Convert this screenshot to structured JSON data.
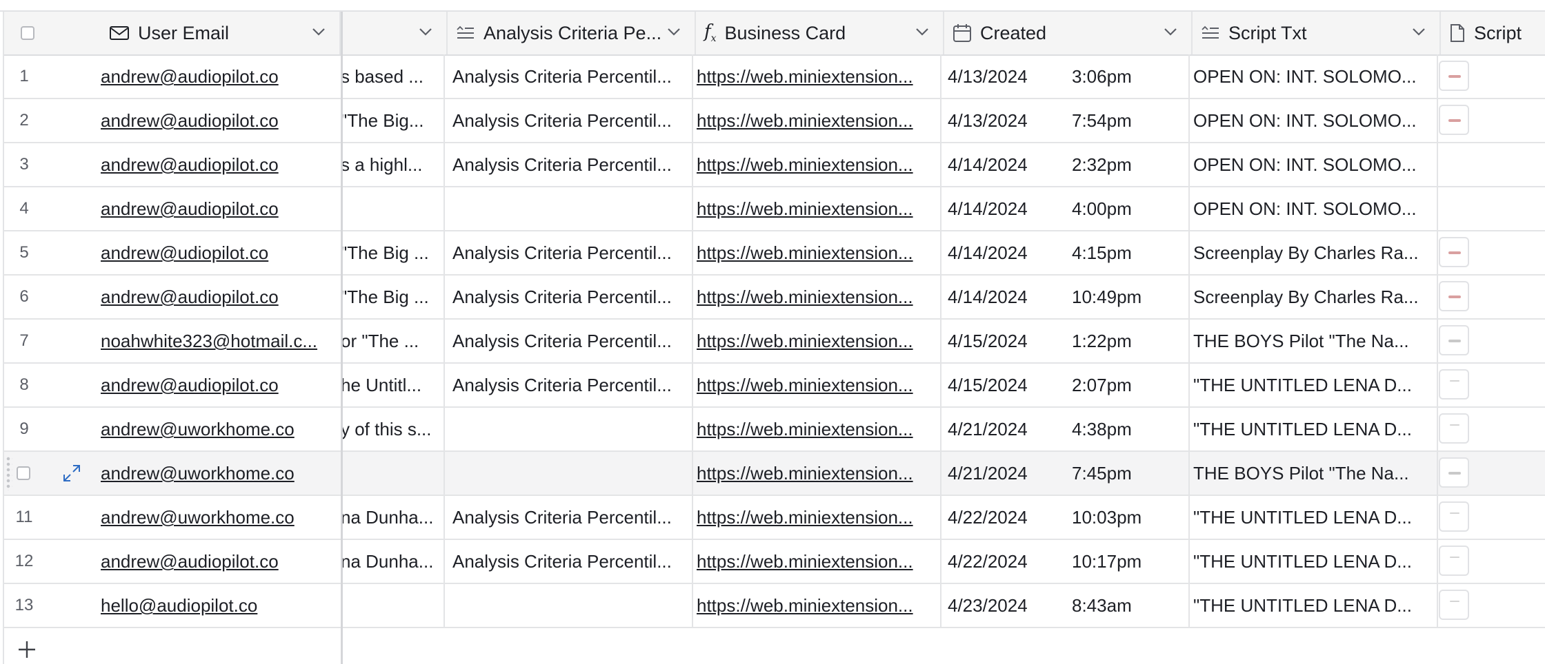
{
  "header": {
    "user_email": "User Email",
    "analysis_criteria": "Analysis Criteria Pe...",
    "business_card": "Business Card",
    "created": "Created",
    "script_txt": "Script Txt",
    "script": "Script"
  },
  "rows": [
    {
      "num": "1",
      "email": "andrew@audiopilot.co",
      "c1": "s based ...",
      "c2": "Analysis Criteria Percentil...",
      "c3": "https://web.miniextension...",
      "date": "4/13/2024",
      "time": "3:06pm",
      "c5": "OPEN ON: INT. SOLOMO...",
      "thumb": "red"
    },
    {
      "num": "2",
      "email": "andrew@audiopilot.co",
      "c1": "\"The Big...",
      "c2": "Analysis Criteria Percentil...",
      "c3": "https://web.miniextension...",
      "date": "4/13/2024",
      "time": "7:54pm",
      "c5": "OPEN ON: INT. SOLOMO...",
      "thumb": "red"
    },
    {
      "num": "3",
      "email": "andrew@audiopilot.co",
      "c1": "s a highl...",
      "c2": "Analysis Criteria Percentil...",
      "c3": "https://web.miniextension...",
      "date": "4/14/2024",
      "time": "2:32pm",
      "c5": "OPEN ON: INT. SOLOMO...",
      "thumb": ""
    },
    {
      "num": "4",
      "email": "andrew@audiopilot.co",
      "c1": "",
      "c2": "",
      "c3": "https://web.miniextension...",
      "date": "4/14/2024",
      "time": "4:00pm",
      "c5": "OPEN ON: INT. SOLOMO...",
      "thumb": ""
    },
    {
      "num": "5",
      "email": "andrew@udiopilot.co",
      "c1": "\"The Big ...",
      "c2": "Analysis Criteria Percentil...",
      "c3": "https://web.miniextension...",
      "date": "4/14/2024",
      "time": "4:15pm",
      "c5": "Screenplay By Charles Ra...",
      "thumb": "red"
    },
    {
      "num": "6",
      "email": "andrew@audiopilot.co",
      "c1": "\"The Big ...",
      "c2": "Analysis Criteria Percentil...",
      "c3": "https://web.miniextension...",
      "date": "4/14/2024",
      "time": "10:49pm",
      "c5": "Screenplay By Charles Ra...",
      "thumb": "red"
    },
    {
      "num": "7",
      "email": "noahwhite323@hotmail.c...",
      "c1": "or \"The ...",
      "c2": "Analysis Criteria Percentil...",
      "c3": "https://web.miniextension...",
      "date": "4/15/2024",
      "time": "1:22pm",
      "c5": "THE BOYS Pilot \"The Na...",
      "thumb": "grey"
    },
    {
      "num": "8",
      "email": "andrew@audiopilot.co",
      "c1": "he Untitl...",
      "c2": "Analysis Criteria Percentil...",
      "c3": "https://web.miniextension...",
      "date": "4/15/2024",
      "time": "2:07pm",
      "c5": "\"THE UNTITLED LENA D...",
      "thumb": "line"
    },
    {
      "num": "9",
      "email": "andrew@uworkhome.co",
      "c1": "y of this s...",
      "c2": "",
      "c3": "https://web.miniextension...",
      "date": "4/21/2024",
      "time": "4:38pm",
      "c5": "\"THE UNTITLED LENA D...",
      "thumb": "line"
    },
    {
      "num": "",
      "email": "andrew@uworkhome.co",
      "c1": "",
      "c2": "",
      "c3": "https://web.miniextension...",
      "date": "4/21/2024",
      "time": "7:45pm",
      "c5": "THE BOYS Pilot \"The Na...",
      "thumb": "grey",
      "hl": true
    },
    {
      "num": "11",
      "email": "andrew@uworkhome.co",
      "c1": "na Dunha...",
      "c2": "Analysis Criteria Percentil...",
      "c3": "https://web.miniextension...",
      "date": "4/22/2024",
      "time": "10:03pm",
      "c5": "\"THE UNTITLED LENA D...",
      "thumb": "line"
    },
    {
      "num": "12",
      "email": "andrew@audiopilot.co",
      "c1": "na Dunha...",
      "c2": "Analysis Criteria Percentil...",
      "c3": "https://web.miniextension...",
      "date": "4/22/2024",
      "time": "10:17pm",
      "c5": "\"THE UNTITLED LENA D...",
      "thumb": "line"
    },
    {
      "num": "13",
      "email": "hello@audiopilot.co",
      "c1": "",
      "c2": "",
      "c3": "https://web.miniextension...",
      "date": "4/23/2024",
      "time": "8:43am",
      "c5": "\"THE UNTITLED LENA D...",
      "thumb": "line"
    }
  ],
  "icons": {
    "email": "mail-icon",
    "analysis": "long-text-icon",
    "business": "formula-icon",
    "created": "calendar-icon",
    "script_txt": "long-text-icon",
    "script": "file-icon",
    "expand": "expand-icon",
    "add": "plus-icon"
  }
}
